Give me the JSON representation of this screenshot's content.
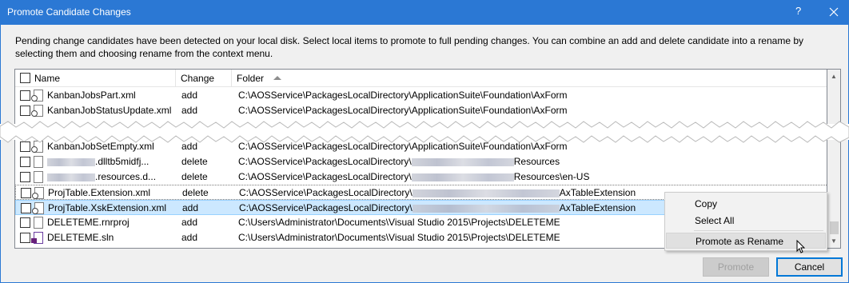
{
  "window": {
    "title": "Promote Candidate Changes",
    "help_glyph": "?",
    "close_glyph": "✕"
  },
  "description": "Pending change candidates have been detected on your local disk. Select local items to promote to full pending changes. You can combine an add and delete candidate into a rename by selecting them and choosing rename from the context menu.",
  "columns": {
    "name": "Name",
    "change": "Change",
    "folder": "Folder",
    "sort_indicator": "ascending"
  },
  "rows_top": [
    {
      "name": "KanbanJobsPart.xml",
      "change": "add",
      "folder": "C:\\AOSService\\PackagesLocalDirectory\\ApplicationSuite\\Foundation\\AxForm"
    },
    {
      "name": "KanbanJobStatusUpdate.xml",
      "change": "add",
      "folder": "C:\\AOSService\\PackagesLocalDirectory\\ApplicationSuite\\Foundation\\AxForm"
    }
  ],
  "rows_bottom": [
    {
      "name": "KanbanJobSetEmpty.xml",
      "change": "add",
      "folder": "C:\\AOSService\\PackagesLocalDirectory\\ApplicationSuite\\Foundation\\AxForm"
    },
    {
      "name_suffix": ".dlltb5midfj...",
      "change": "delete",
      "folder_prefix": "C:\\AOSService\\PackagesLocalDirectory\\",
      "folder_suffix": "Resources"
    },
    {
      "name_suffix": ".resources.d...",
      "change": "delete",
      "folder_prefix": "C:\\AOSService\\PackagesLocalDirectory\\",
      "folder_suffix": "Resources\\en-US"
    },
    {
      "name": "ProjTable.Extension.xml",
      "change": "delete",
      "folder_prefix": "C:\\AOSService\\PackagesLocalDirectory\\",
      "folder_suffix": "AxTableExtension"
    },
    {
      "name": "ProjTable.XskExtension.xml",
      "change": "add",
      "folder_prefix": "C:\\AOSService\\PackagesLocalDirectory\\",
      "folder_suffix": "AxTableExtension"
    },
    {
      "name": "DELETEME.rnrproj",
      "change": "add",
      "folder": "C:\\Users\\Administrator\\Documents\\Visual Studio 2015\\Projects\\DELETEME"
    },
    {
      "name": "DELETEME.sln",
      "change": "add",
      "folder": "C:\\Users\\Administrator\\Documents\\Visual Studio 2015\\Projects\\DELETEME"
    }
  ],
  "context_menu": {
    "copy": "Copy",
    "select_all": "Select All",
    "promote_as_rename": "Promote as Rename"
  },
  "buttons": {
    "promote": "Promote",
    "cancel": "Cancel"
  },
  "colors": {
    "accent": "#2b78d4",
    "selection": "#cce8ff",
    "dialog_bg": "#f0f0f0"
  }
}
